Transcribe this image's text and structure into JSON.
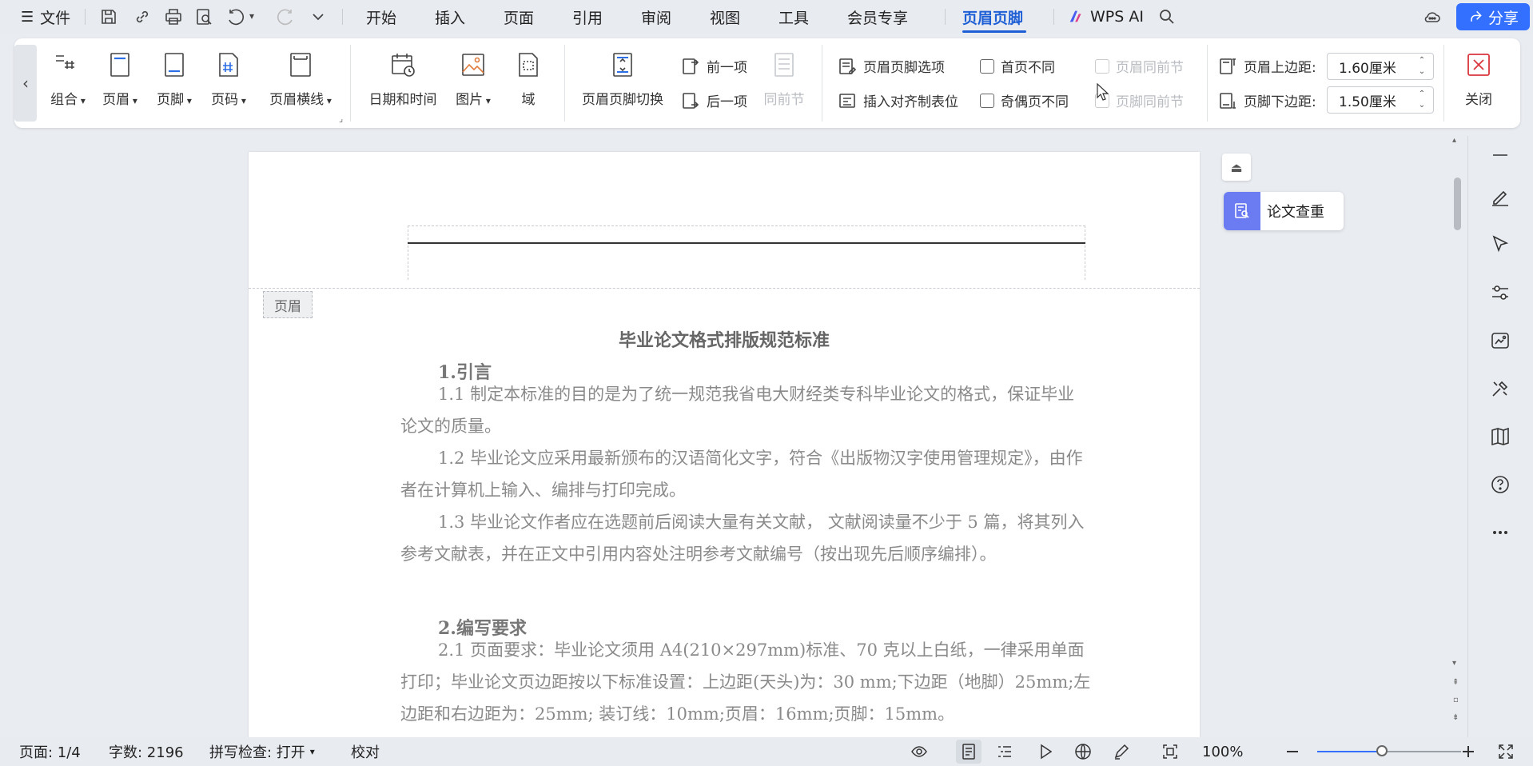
{
  "menubar": {
    "file_label": "文件",
    "tabs": [
      "开始",
      "插入",
      "页面",
      "引用",
      "审阅",
      "视图",
      "工具",
      "会员专享",
      "页眉页脚"
    ],
    "active_tab": "页眉页脚",
    "wps_ai": "WPS AI",
    "share": "分享"
  },
  "ribbon": {
    "group1": [
      "组合",
      "页眉",
      "页脚",
      "页码",
      "页眉横线"
    ],
    "group2": [
      "日期和时间",
      "图片",
      "域"
    ],
    "switch_label": "页眉页脚切换",
    "prev_item": "前一项",
    "next_item": "后一项",
    "same_as_prev": "同前节",
    "options_label": "页眉页脚选项",
    "insert_align_tab": "插入对齐制表位",
    "first_page_diff": "首页不同",
    "odd_even_diff": "奇偶页不同",
    "header_same_prev": "页眉同前节",
    "footer_same_prev": "页脚同前节",
    "header_top_label": "页眉上边距:",
    "header_top_value": "1.60厘米",
    "footer_bottom_label": "页脚下边距:",
    "footer_bottom_value": "1.50厘米",
    "close_label": "关闭"
  },
  "document": {
    "header_tag": "页眉",
    "title": "毕业论文格式排版规范标准",
    "heading1": "1.引言",
    "p1_1": "1.1 制定本标准的目的是为了统一规范我省电大财经类专科毕业论文的格式，保证毕业论文的质量。",
    "p1_2": "1.2 毕业论文应采用最新颁布的汉语简化文字，符合《出版物汉字使用管理规定》，由作者在计算机上输入、编排与打印完成。",
    "p1_3": "1.3 毕业论文作者应在选题前后阅读大量有关文献， 文献阅读量不少于 5 篇，将其列入参考文献表，并在正文中引用内容处注明参考文献编号（按出现先后顺序编排）。",
    "heading2": "2.编写要求",
    "p2_1": "2.1 页面要求：毕业论文须用 A4(210×297mm)标准、70 克以上白纸，一律采用单面打印；毕业论文页边距按以下标准设置：上边距(天头)为：30 mm;下边距（地脚）25mm;左边距和右边距为：25mm; 装订线：10mm;页眉：16mm;页脚：15mm。"
  },
  "side_panel": {
    "lunwen": "论文查重"
  },
  "status": {
    "page": "页面: 1/4",
    "word_count": "字数: 2196",
    "spell_check": "拼写检查: 打开",
    "proofread": "校对",
    "zoom": "100%",
    "zoom_level": 0.45
  },
  "colors": {
    "accent": "#3370ff",
    "active_tab": "#1f5fd6",
    "lunwen_icon": "#6b7cf2"
  }
}
